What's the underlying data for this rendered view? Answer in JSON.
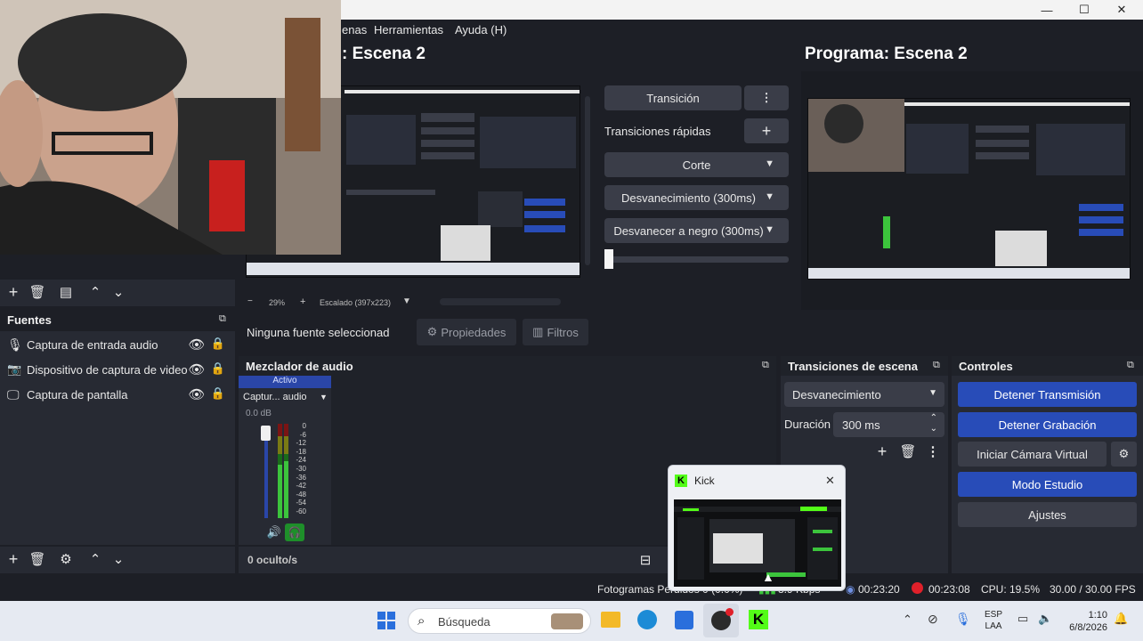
{
  "window": {
    "minimize": "—",
    "maximize": "☐",
    "close": "✕"
  },
  "menu": {
    "item_partial": "enas",
    "tools": "Herramientas",
    "help": "Ayuda (H)"
  },
  "preview": {
    "title": ": Escena 2",
    "zoom": "29%",
    "scale": "Escalado (397x223)"
  },
  "program": {
    "title": "Programa: Escena 2"
  },
  "transition": {
    "button": "Transición",
    "quick_label": "Transiciones rápidas",
    "options": [
      "Corte",
      "Desvanecimiento (300ms)",
      "Desvanecer a negro (300ms)"
    ]
  },
  "toolbar": {
    "no_source": "Ninguna fuente seleccionad",
    "properties": "Propiedades",
    "filters": "Filtros"
  },
  "sources": {
    "title": "Fuentes",
    "items": [
      {
        "name": "Captura de entrada audio"
      },
      {
        "name": "Dispositivo de captura de video"
      },
      {
        "name": "Captura de pantalla"
      }
    ]
  },
  "mixer": {
    "title": "Mezclador de audio",
    "active": "Activo",
    "channel": "Captur... audio",
    "db": "0.0 dB",
    "scale": [
      "0",
      "-6",
      "-12",
      "-18",
      "-24",
      "-30",
      "-36",
      "-42",
      "-48",
      "-54",
      "-60"
    ],
    "hidden": "0 oculto/s"
  },
  "scene_transitions": {
    "title": "Transiciones de escena",
    "type": "Desvanecimiento",
    "duration_label": "Duración",
    "duration_value": "300 ms"
  },
  "controls": {
    "title": "Controles",
    "stop_stream": "Detener Transmisión",
    "stop_record": "Detener Grabación",
    "virtual_cam": "Iniciar Cámara Virtual",
    "studio_mode": "Modo Estudio",
    "settings": "Ajustes"
  },
  "kick_popup": {
    "title": "Kick"
  },
  "statusbar": {
    "frames": "Fotogramas Perdidos 0 (0.0%)",
    "kbps": "8.9 Kbps",
    "stream_time": "00:23:20",
    "rec_time": "00:23:08",
    "cpu": "CPU: 19.5%",
    "fps": "30.00 / 30.00 FPS"
  },
  "taskbar": {
    "search": "Búsqueda",
    "lang_1": "ESP",
    "lang_2": "LAA",
    "time": "1:10",
    "date": "6/8/2026"
  },
  "colors": {
    "accent": "#284cb8",
    "kick_green": "#53fc18",
    "meter_green": "#3cc43c",
    "record_red": "#e0202a"
  }
}
